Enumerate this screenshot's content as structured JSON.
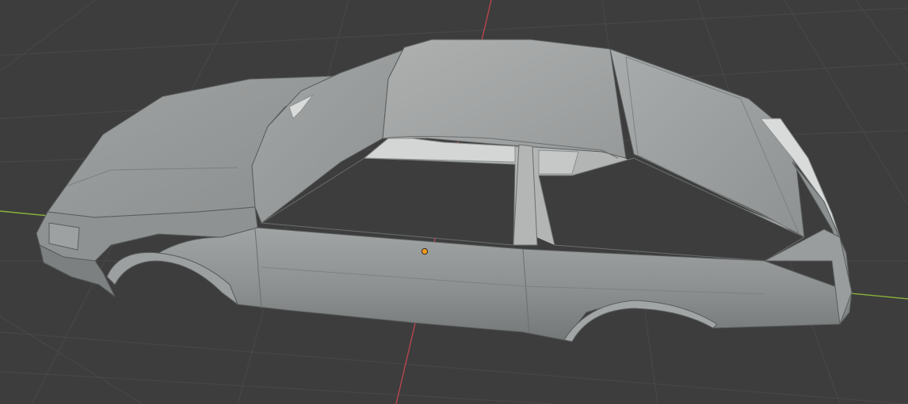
{
  "viewport": {
    "background_color": "#3d3d3d",
    "grid_color": "#474747",
    "x_axis_color": "#8ab33a",
    "y_axis_color": "#b8454f"
  },
  "scene": {
    "object": "car-body-mesh",
    "shading": "solid",
    "mesh_color": "#a3a6a6",
    "origin_color": "#f29a1d"
  }
}
